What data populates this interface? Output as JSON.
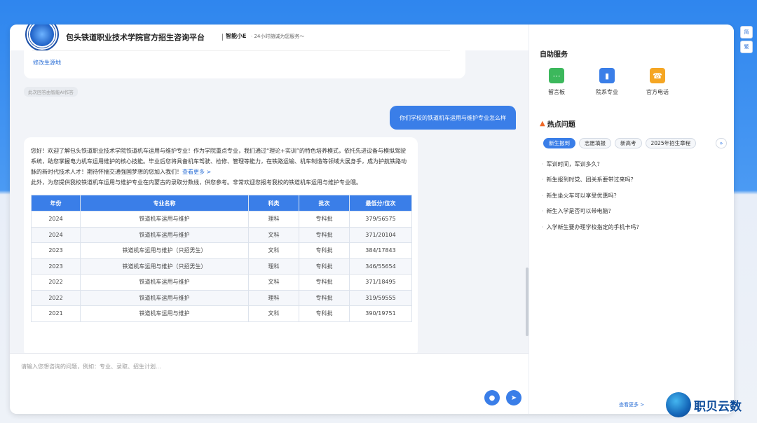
{
  "header": {
    "title": "包头铁道职业技术学院官方招生咨询平台",
    "assistant": "智能小E",
    "tagline": "· 24小时随诚为您服务～"
  },
  "chat": {
    "edit_link": "修改生源地",
    "ai_note": "此次回答由智能AI作答",
    "user_question": "你们学校的铁道机车运用与维护专业怎么样",
    "answer_p1": "您好！欢迎了解包头铁道职业技术学院铁道机车运用与维护专业！作为学院重点专业，我们通过“理论+实训”的特色培养模式，依托先进设备与模拟驾驶系统，助您掌握电力机车运用维护的核心技能。毕业后您将具备机车驾驶、检修、管理等能力，在铁路运输、机车制造等领域大展身手，成为护航铁路动脉的新时代技术人才！期待怀揣交通强国梦想的您加入我们！",
    "answer_more": "查看更多 >",
    "answer_p2": "此外，为您提供我校铁道机车运用与维护专业在内蒙古的录取分数线，供您参考。非常欢迎您报考我校的铁道机车运用与维护专业哦。",
    "table": {
      "headers": [
        "年份",
        "专业名称",
        "科类",
        "批次",
        "最低分/位次"
      ],
      "rows": [
        [
          "2024",
          "铁道机车运用与维护",
          "理科",
          "专科批",
          "379/56575"
        ],
        [
          "2024",
          "铁道机车运用与维护",
          "文科",
          "专科批",
          "371/20104"
        ],
        [
          "2023",
          "铁道机车运用与维护（只招男生）",
          "文科",
          "专科批",
          "384/17843"
        ],
        [
          "2023",
          "铁道机车运用与维护（只招男生）",
          "理科",
          "专科批",
          "346/55654"
        ],
        [
          "2022",
          "铁道机车运用与维护",
          "文科",
          "专科批",
          "371/18495"
        ],
        [
          "2022",
          "铁道机车运用与维护",
          "理科",
          "专科批",
          "319/59555"
        ],
        [
          "2021",
          "铁道机车运用与维护",
          "文科",
          "专科批",
          "390/19751"
        ]
      ]
    }
  },
  "input": {
    "placeholder": "请输入您想咨询的问题，例如：专业、录取、招生计划..."
  },
  "side": {
    "self_service_title": "自助服务",
    "services": [
      {
        "label": "留言板",
        "icon": "message-board-icon",
        "color": "#3cb85c"
      },
      {
        "label": "院系专业",
        "icon": "book-icon",
        "color": "#3a7ee8"
      },
      {
        "label": "官方电话",
        "icon": "phone-icon",
        "color": "#f5a623"
      }
    ],
    "hot_title": "热点问题",
    "tabs": [
      "新生报到",
      "志愿填报",
      "新高考",
      "2025年招生章程"
    ],
    "questions": [
      "军训时间，军训多久？",
      "新生报到时党、团关系要带过来吗？",
      "新生坐火车可以享受优惠吗？",
      "新生入学是否可以带电脑？",
      "入学新生要办理学校指定的手机卡吗？"
    ],
    "see_more": "查看更多 >"
  },
  "pins": [
    "简",
    "繁"
  ],
  "brand": "职贝云数"
}
